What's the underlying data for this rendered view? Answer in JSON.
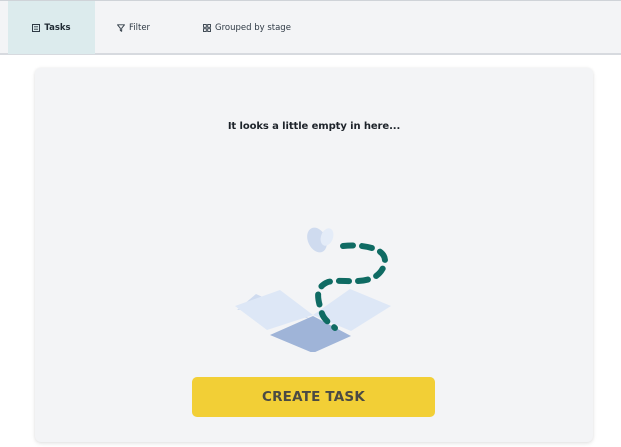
{
  "toolbar": {
    "tabs": [
      {
        "label": "Tasks",
        "icon": "task-list-icon"
      },
      {
        "label": "Filter",
        "icon": "filter-icon"
      },
      {
        "label": "Grouped by stage",
        "icon": "grid-icon"
      }
    ]
  },
  "empty_state": {
    "message": "It looks a little empty in here...",
    "illustration": "open-box-with-butterfly"
  },
  "actions": {
    "create_label": "CREATE TASK"
  },
  "colors": {
    "accent_yellow": "#f2cf36",
    "active_tab_bg": "#dcebed",
    "dashed_path": "#0f6b63",
    "box_light": "#cfdbef",
    "box_dark": "#9fb4d8"
  }
}
